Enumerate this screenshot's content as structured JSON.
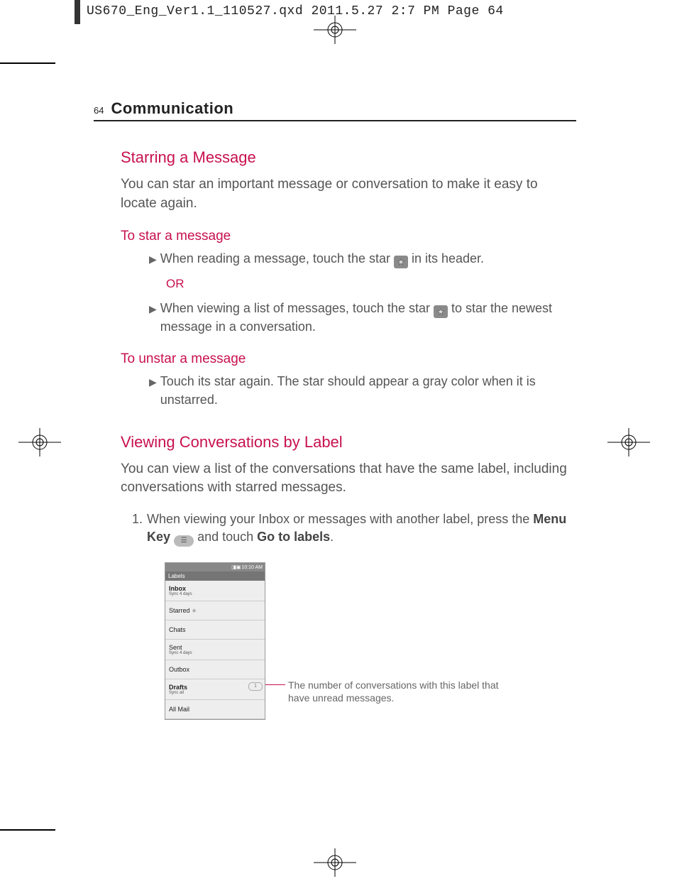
{
  "print_header": "US670_Eng_Ver1.1_110527.qxd  2011.5.27  2:7 PM  Page 64",
  "page_number": "64",
  "section": "Communication",
  "h2_1": "Starring a Message",
  "p1": "You can star an important message or conversation to make it easy to locate again.",
  "h3_1": "To star a message",
  "b1a": "When reading a message, touch the star ",
  "b1b": " in its header.",
  "or": "OR",
  "b2a": "When viewing a list of messages, touch the star ",
  "b2b": " to star the newest message in a conversation.",
  "h3_2": "To unstar a message",
  "b3": "Touch its star again. The star should appear a gray color when it is unstarred.",
  "h2_2": "Viewing Conversations by Label",
  "p2": "You can view a list of the conversations that have the same label, including conversations with starred messages.",
  "n1a": "When viewing your Inbox or messages with another label, press the ",
  "n1_menu": "Menu Key",
  "n1b": " and touch ",
  "n1_goto": "Go to labels",
  "n1c": ".",
  "callout": "The number of conversations with this label that have unread messages.",
  "phone": {
    "status_icons": "▯▮ ▣",
    "time": "10:10 AM",
    "header": "Labels",
    "rows": [
      {
        "title": "Inbox",
        "bold": true,
        "sub": "Sync 4 days"
      },
      {
        "title": "Starred",
        "star": true
      },
      {
        "title": "Chats"
      },
      {
        "title": "Sent",
        "sub": "Sync 4 days"
      },
      {
        "title": "Outbox"
      },
      {
        "title": "Drafts",
        "bold": true,
        "sub": "Sync all",
        "count": "1"
      },
      {
        "title": "All Mail"
      }
    ]
  }
}
